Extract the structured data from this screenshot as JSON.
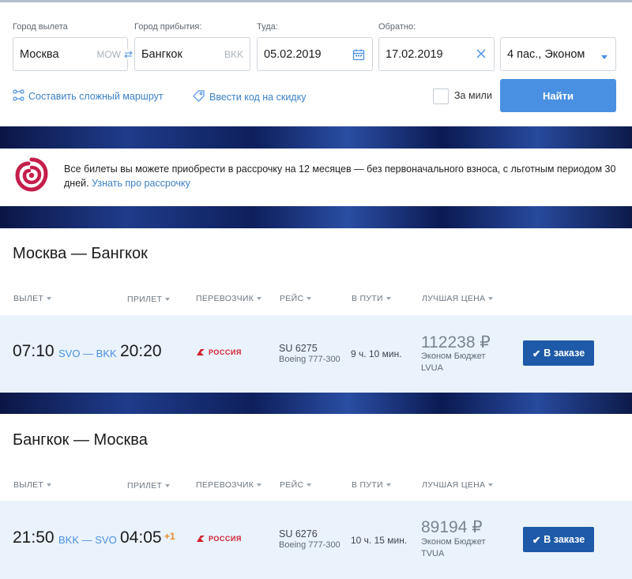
{
  "search": {
    "from_label": "Город вылета",
    "from_value": "Москва",
    "from_code": "MOW",
    "to_label": "Город прибытия:",
    "to_value": "Бангкок",
    "to_code": "BKK",
    "depart_label": "Туда:",
    "depart_value": "05.02.2019",
    "return_label": "Обратно:",
    "return_value": "17.02.2019",
    "passengers_value": "4 пас., Эконом",
    "complex_route": "Составить сложный маршрут",
    "promo_code": "Ввести код на скидку",
    "miles_label": "За мили",
    "find_button": "Найти"
  },
  "promo": {
    "text": "Все билеты вы можете приобрести в рассрочку на 12 месяцев — без первоначального взноса, с льготным периодом 30 дней.",
    "link": "Узнать про рассрочку"
  },
  "columns": {
    "depart": "ВЫЛЕТ",
    "arrive": "ПРИЛЕТ",
    "carrier": "ПЕРЕВОЗЧИК",
    "flight": "РЕЙС",
    "duration": "В ПУТИ",
    "best_price": "ЛУЧШАЯ ЦЕНА"
  },
  "outbound": {
    "title": "Москва — Бангкок",
    "dep_time": "07:10",
    "route": "SVO — BKK",
    "arr_time": "20:20",
    "carrier": "РОССИЯ",
    "flight_no": "SU 6275",
    "aircraft": "Boeing 777-300",
    "duration": "9 ч. 10 мин.",
    "price": "112238 ₽",
    "fare": "Эконом Бюджет",
    "fare_code": "LVUA",
    "order_button": "В заказе"
  },
  "inbound": {
    "title": "Бангкок — Москва",
    "dep_time": "21:50",
    "route": "BKK — SVO",
    "arr_time": "04:05",
    "day_shift": "+1",
    "carrier": "РОССИЯ",
    "flight_no": "SU 6276",
    "aircraft": "Boeing 777-300",
    "duration": "10 ч. 15 мин.",
    "price": "89194 ₽",
    "fare": "Эконом Бюджет",
    "fare_code": "TVUA",
    "order_button": "В заказе"
  },
  "colors": {
    "accent": "#4a90e2",
    "order_button": "#1e5aa8",
    "row_bg": "#eaf2fb",
    "brand_red": "#d21f2b"
  }
}
